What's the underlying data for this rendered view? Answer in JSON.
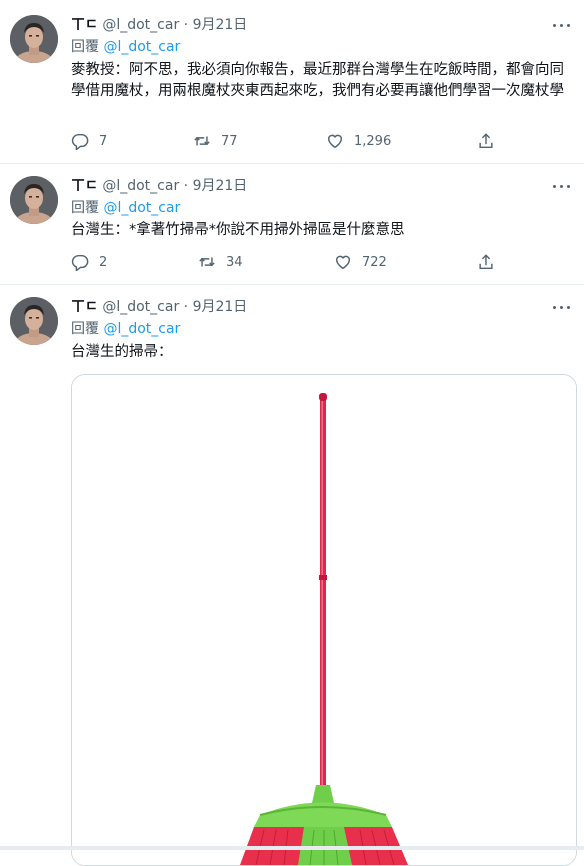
{
  "tweets": [
    {
      "display_name": "ㄒㄷ",
      "handle": "@l_dot_car",
      "date": "9月21日",
      "reply_prefix": "回覆",
      "reply_to": "@l_dot_car",
      "text": "麥教授：阿不思，我必須向你報告，最近那群台灣學生在吃飯時間，都會向同學借用魔杖，用兩根魔杖夾東西起來吃，我們有必要再讓他們學習一次魔杖學",
      "replies": "7",
      "retweets": "77",
      "likes": "1,296"
    },
    {
      "display_name": "ㄒㄷ",
      "handle": "@l_dot_car",
      "date": "9月21日",
      "reply_prefix": "回覆",
      "reply_to": "@l_dot_car",
      "text": "台灣生：*拿著竹掃帚*你說不用掃外掃區是什麼意思",
      "replies": "2",
      "retweets": "34",
      "likes": "722"
    },
    {
      "display_name": "ㄒㄷ",
      "handle": "@l_dot_car",
      "date": "9月21日",
      "reply_prefix": "回覆",
      "reply_to": "@l_dot_car",
      "text": "台灣生的掃帚："
    }
  ],
  "icons": {
    "reply": "reply-icon",
    "retweet": "retweet-icon",
    "like": "heart-icon",
    "share": "share-icon",
    "more": "more-icon",
    "media": "broom-image"
  },
  "colors": {
    "accent": "#1d9bf0",
    "secondary_text": "#536471",
    "divider": "#e6ecf0",
    "broom_handle": "#e0264f",
    "broom_head": "#7ed957"
  }
}
